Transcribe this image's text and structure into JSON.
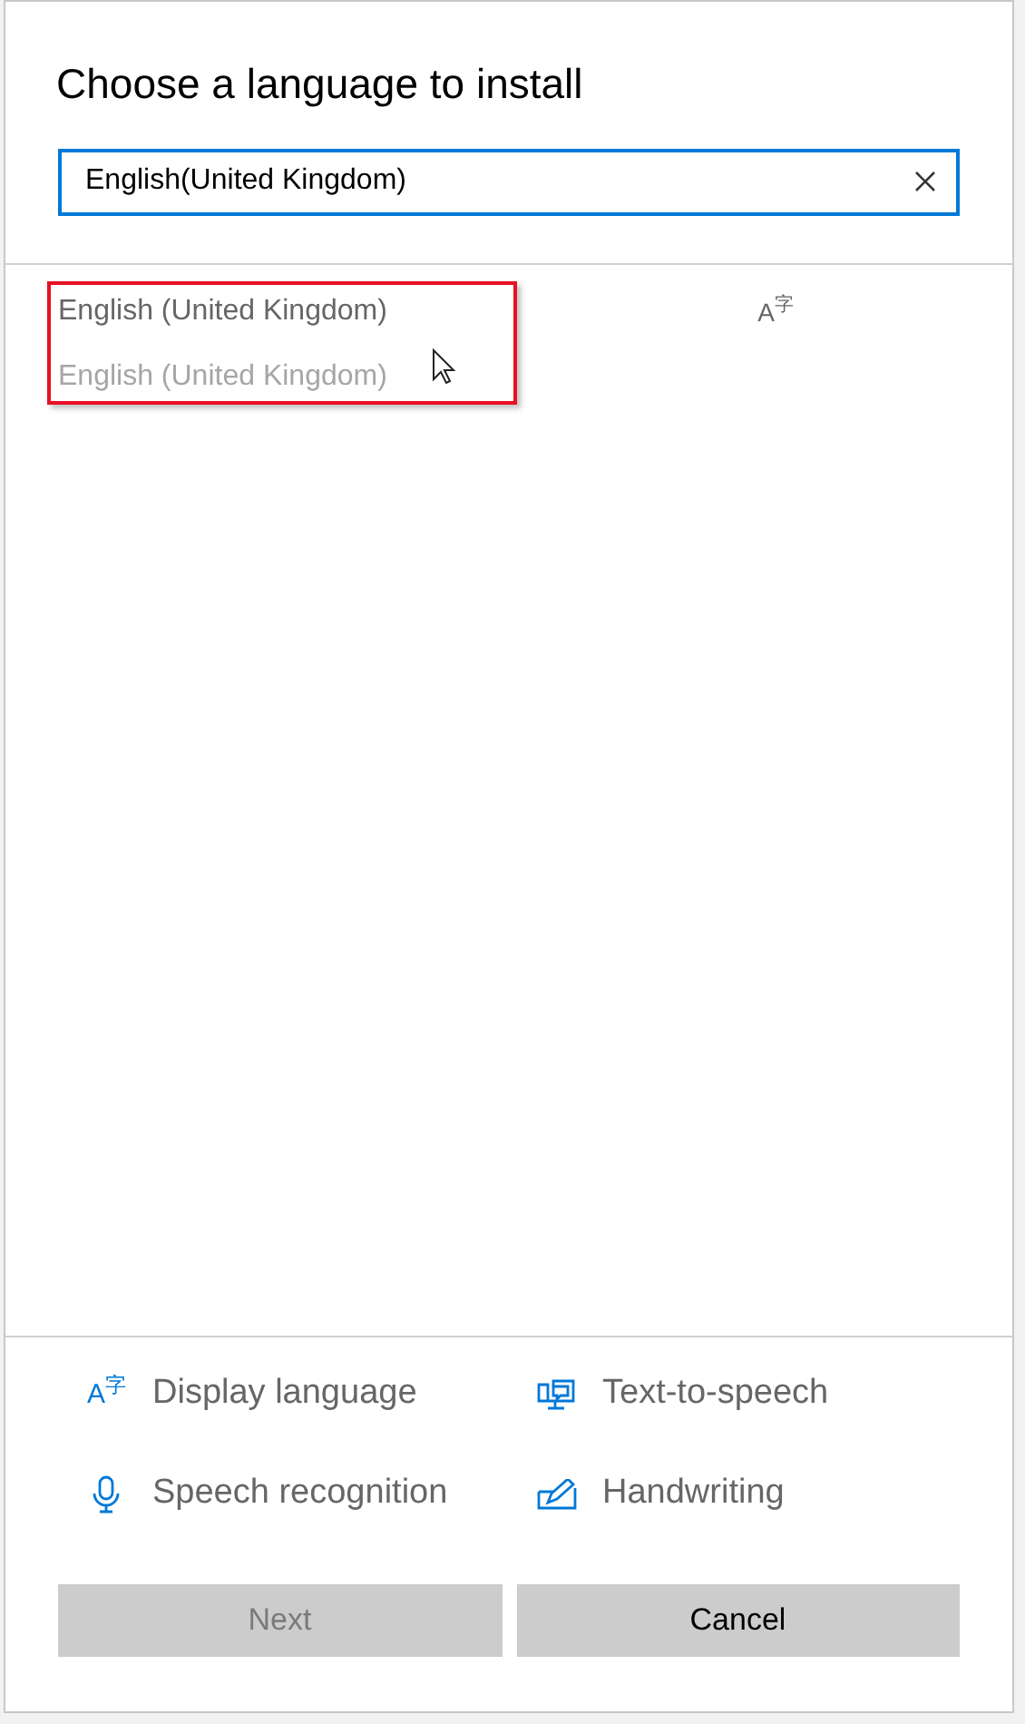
{
  "dialog": {
    "title": "Choose a language to install"
  },
  "search": {
    "value": "English(United Kingdom)"
  },
  "results": [
    {
      "label": "English (United Kingdom)",
      "disabled": false,
      "glyph": "A$^{字}$"
    },
    {
      "label": "English (United Kingdom)",
      "disabled": true
    }
  ],
  "features": [
    {
      "kind": "display",
      "label": "Display language",
      "glyph": "A$^{字}$"
    },
    {
      "kind": "tts",
      "label": "Text-to-speech"
    },
    {
      "kind": "speech",
      "label": "Speech recognition"
    },
    {
      "kind": "handwriting",
      "label": "Handwriting"
    }
  ],
  "buttons": [
    {
      "label": "Next",
      "disabled": true
    },
    {
      "label": "Cancel",
      "disabled": false
    }
  ]
}
